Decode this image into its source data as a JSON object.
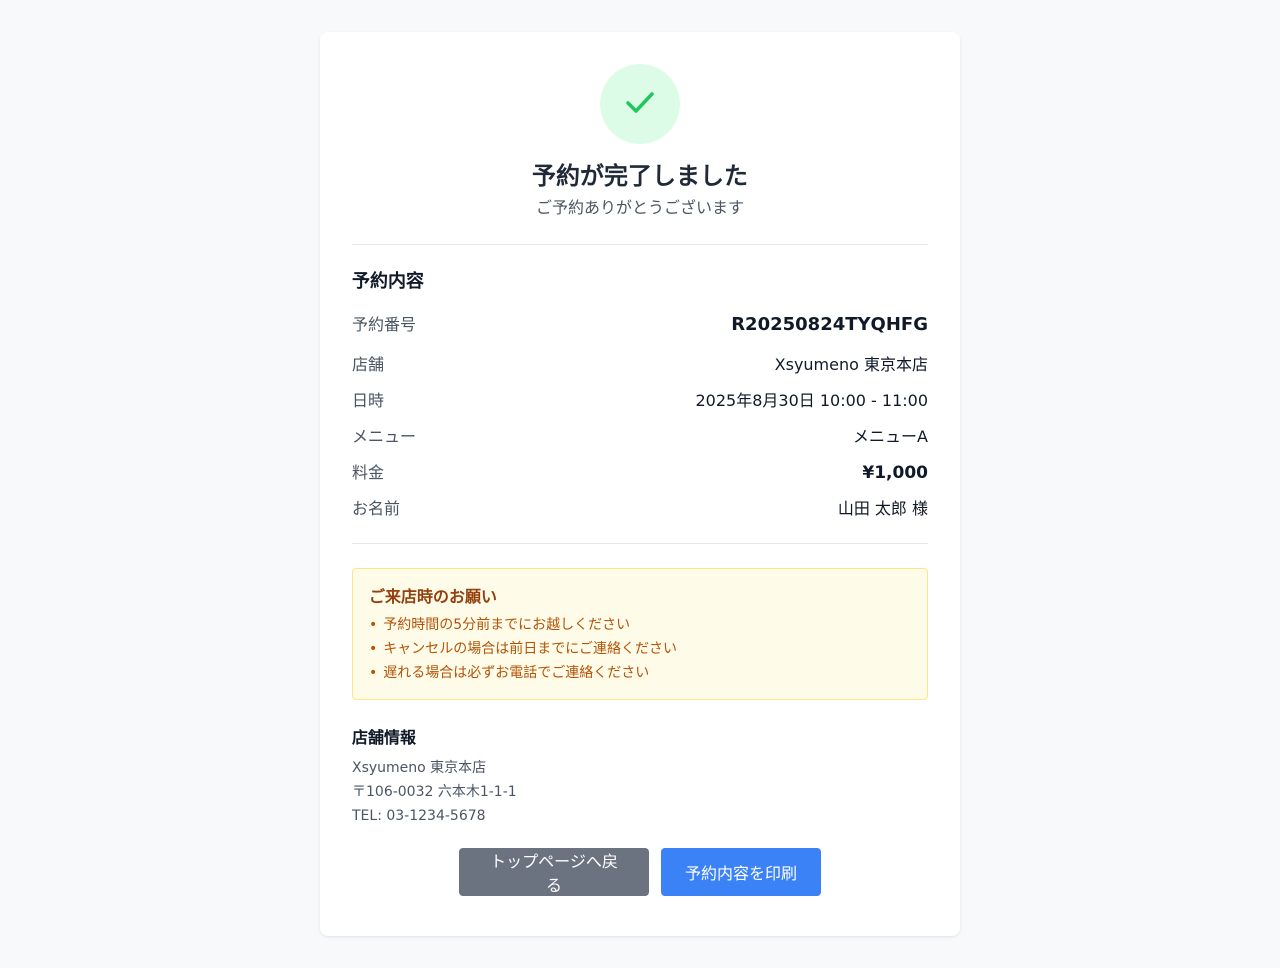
{
  "header": {
    "title": "予約が完了しました",
    "subtitle": "ご予約ありがとうございます"
  },
  "details": {
    "section_title": "予約内容",
    "rows": [
      {
        "label": "予約番号",
        "value": "R20250824TYQHFG"
      },
      {
        "label": "店舗",
        "value": "Xsyumeno 東京本店"
      },
      {
        "label": "日時",
        "value": "2025年8月30日 10:00 - 11:00"
      },
      {
        "label": "メニュー",
        "value": "メニューA"
      },
      {
        "label": "料金",
        "value": "¥1,000"
      },
      {
        "label": "お名前",
        "value": "山田 太郎 様"
      }
    ]
  },
  "notice": {
    "title": "ご来店時のお願い",
    "items": [
      "予約時間の5分前までにお越しください",
      "キャンセルの場合は前日までにご連絡ください",
      "遅れる場合は必ずお電話でご連絡ください"
    ]
  },
  "store": {
    "title": "店舗情報",
    "name": "Xsyumeno 東京本店",
    "address": "〒106-0032 六本木1-1-1",
    "tel": "TEL: 03-1234-5678"
  },
  "buttons": {
    "back_label": "トップページへ戻る",
    "print_label": "予約内容を印刷"
  },
  "colors": {
    "success_bg": "#dcfce7",
    "success_icon": "#22c55e",
    "notice_bg": "#fefce8",
    "notice_border": "#fde68a",
    "notice_text": "#b45309",
    "back_button": "#6b7280",
    "print_button": "#3b82f6"
  },
  "icons": {
    "success": "check-icon"
  }
}
